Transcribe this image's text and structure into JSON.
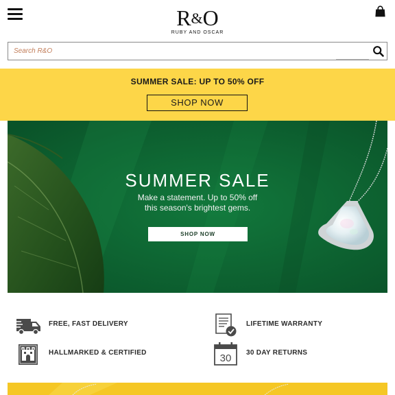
{
  "header": {
    "menu_icon": "hamburger-menu-icon",
    "logo": {
      "mark_left": "R",
      "mark_amp": "&",
      "mark_right": "O",
      "subtitle": "RUBY AND OSCAR"
    },
    "bag_icon": "shopping-bag-icon"
  },
  "search": {
    "placeholder": "Search R&O",
    "value": "",
    "icon": "search-icon"
  },
  "promo": {
    "text": "SUMMER SALE: UP TO 50% OFF",
    "button_label": "SHOP NOW",
    "background": "#fdd648"
  },
  "hero": {
    "title": "SUMMER SALE",
    "subtitle": "Make a statement. Up to 50% off this season's brightest gems.",
    "button_label": "SHOP NOW",
    "background": "#0f6a35"
  },
  "features": [
    {
      "label": "FREE, FAST DELIVERY",
      "icon": "delivery-truck-icon"
    },
    {
      "label": "LIFETIME WARRANTY",
      "icon": "warranty-certificate-icon"
    },
    {
      "label": "HALLMARKED & CERTIFIED",
      "icon": "hallmark-icon"
    },
    {
      "label": "30 DAY RETURNS",
      "icon": "calendar-returns-icon",
      "calendar_number": "30"
    }
  ]
}
